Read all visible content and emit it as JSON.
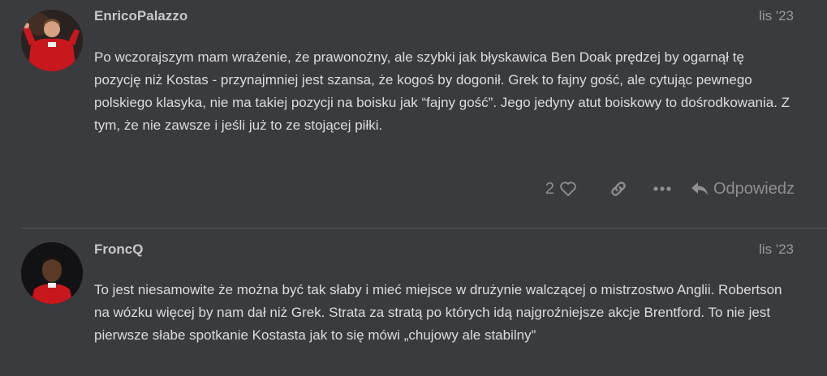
{
  "posts": [
    {
      "username": "EnricoPalazzo",
      "date": "lis '23",
      "body": "Po wczorajszym mam wrażenie, że prawonożny, ale szybki jak błyskawica Ben Doak prędzej by ogarnął tę pozycję niż Kostas - przynajmniej jest szansa, że kogoś by dogonił. Grek to fajny gość, ale cytując pewnego polskiego klasyka, nie ma takiej pozycji na boisku jak “fajny gość”. Jego jedyny atut boiskowy to dośrodkowania. Z tym, że nie zawsze i jeśli już to ze stojącej piłki.",
      "likes": "2",
      "reply_label": "Odpowiedz"
    },
    {
      "username": "FroncQ",
      "date": "lis '23",
      "body": "To jest niesamowite że można być tak słaby i mieć miejsce w drużynie walczącej o mistrzostwo Anglii. Robertson na wózku więcej by nam dał niż Grek. Strata za stratą po których idą najgroźniejsze akcje Brentford. To nie jest pierwsze słabe spotkanie Kostasta jak to się mówi „chujowy ale stabilny”"
    }
  ],
  "icons": {
    "like": "heart-icon",
    "link": "link-icon",
    "more": "ellipsis-icon",
    "reply": "reply-icon"
  },
  "colors": {
    "background": "#3a3b3f",
    "text": "#dcdcdc",
    "muted": "#8f8f8f",
    "divider": "#55565a"
  }
}
